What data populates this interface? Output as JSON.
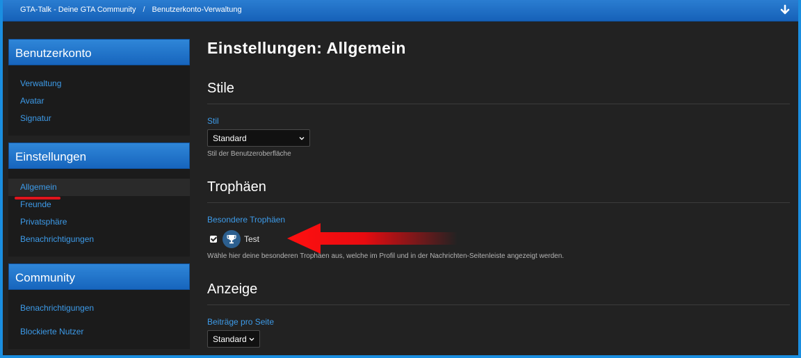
{
  "breadcrumb": {
    "items": [
      "GTA-Talk - Deine GTA Community",
      "Benutzerkonto-Verwaltung"
    ],
    "separator": "/"
  },
  "sidebar": {
    "sections": [
      {
        "title": "Benutzerkonto",
        "items": [
          "Verwaltung",
          "Avatar",
          "Signatur"
        ]
      },
      {
        "title": "Einstellungen",
        "items": [
          "Allgemein",
          "Freunde",
          "Privatsphäre",
          "Benachrichtigungen"
        ],
        "active": "Allgemein"
      },
      {
        "title": "Community",
        "items": [
          "Benachrichtigungen",
          "Blockierte Nutzer"
        ]
      }
    ]
  },
  "main": {
    "title": "Einstellungen: Allgemein",
    "stile": {
      "section": "Stile",
      "label": "Stil",
      "value": "Standard",
      "help": "Stil der Benutzeroberfläche"
    },
    "trophaeen": {
      "section": "Trophäen",
      "label": "Besondere Trophäen",
      "trophy_name": "Test",
      "checked": true,
      "help": "Wähle hier deine besonderen Trophäen aus, welche im Profil und in der Nachrichten-Seitenleiste angezeigt werden."
    },
    "anzeige": {
      "section": "Anzeige",
      "label": "Beiträge pro Seite",
      "value": "Standard"
    }
  },
  "colors": {
    "accent": "#3d9be9",
    "header": "#1765bd",
    "annotation": "#e0141c"
  },
  "icons": {
    "jump": "arrow-down-icon",
    "trophy": "trophy-icon",
    "select": "chevron-down-icon"
  }
}
